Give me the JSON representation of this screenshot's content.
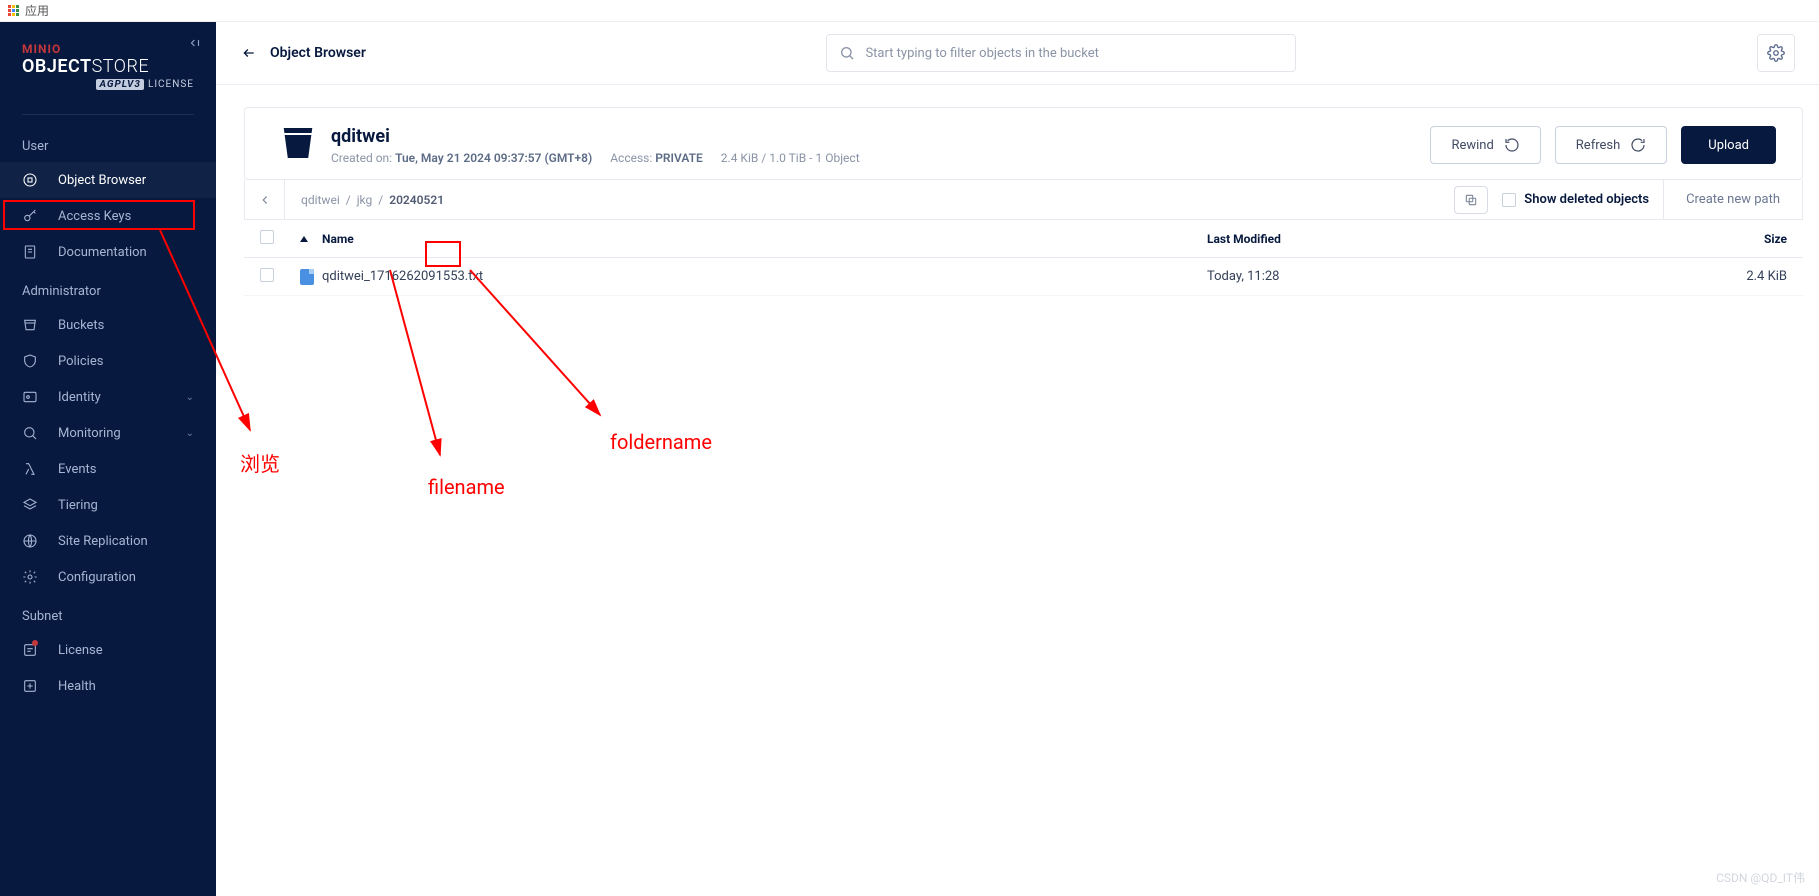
{
  "browser": {
    "apps_label": "应用"
  },
  "sidebar": {
    "logo_top": "MINIO",
    "logo_main_bold": "OBJECT",
    "logo_main_thin": "STORE",
    "logo_sub_agpl": "AGPLV3",
    "logo_sub_license": "LICENSE",
    "sections": {
      "user": "User",
      "administrator": "Administrator",
      "subnet": "Subnet"
    },
    "items": {
      "object_browser": "Object Browser",
      "access_keys": "Access Keys",
      "documentation": "Documentation",
      "buckets": "Buckets",
      "policies": "Policies",
      "identity": "Identity",
      "monitoring": "Monitoring",
      "events": "Events",
      "tiering": "Tiering",
      "site_replication": "Site Replication",
      "configuration": "Configuration",
      "license": "License",
      "health": "Health"
    }
  },
  "topbar": {
    "title": "Object Browser",
    "search_placeholder": "Start typing to filter objects in the bucket"
  },
  "bucket": {
    "name": "qditwei",
    "created_label": "Created on:",
    "created_value": "Tue, May 21 2024 09:37:57 (GMT+8)",
    "access_label": "Access:",
    "access_value": "PRIVATE",
    "stats": "2.4 KiB / 1.0 TiB - 1 Object",
    "actions": {
      "rewind": "Rewind",
      "refresh": "Refresh",
      "upload": "Upload"
    }
  },
  "path": {
    "crumbs": [
      "qditwei",
      "jkg",
      "20240521"
    ],
    "show_deleted": "Show deleted objects",
    "new_path": "Create new path"
  },
  "table": {
    "headers": {
      "name": "Name",
      "modified": "Last Modified",
      "size": "Size"
    },
    "rows": [
      {
        "name": "qditwei_1716262091553.txt",
        "modified": "Today, 11:28",
        "size": "2.4 KiB"
      }
    ]
  },
  "annotations": {
    "browse": "浏览",
    "filename": "filename",
    "foldername": "foldername",
    "watermark": "CSDN @QD_IT伟"
  }
}
